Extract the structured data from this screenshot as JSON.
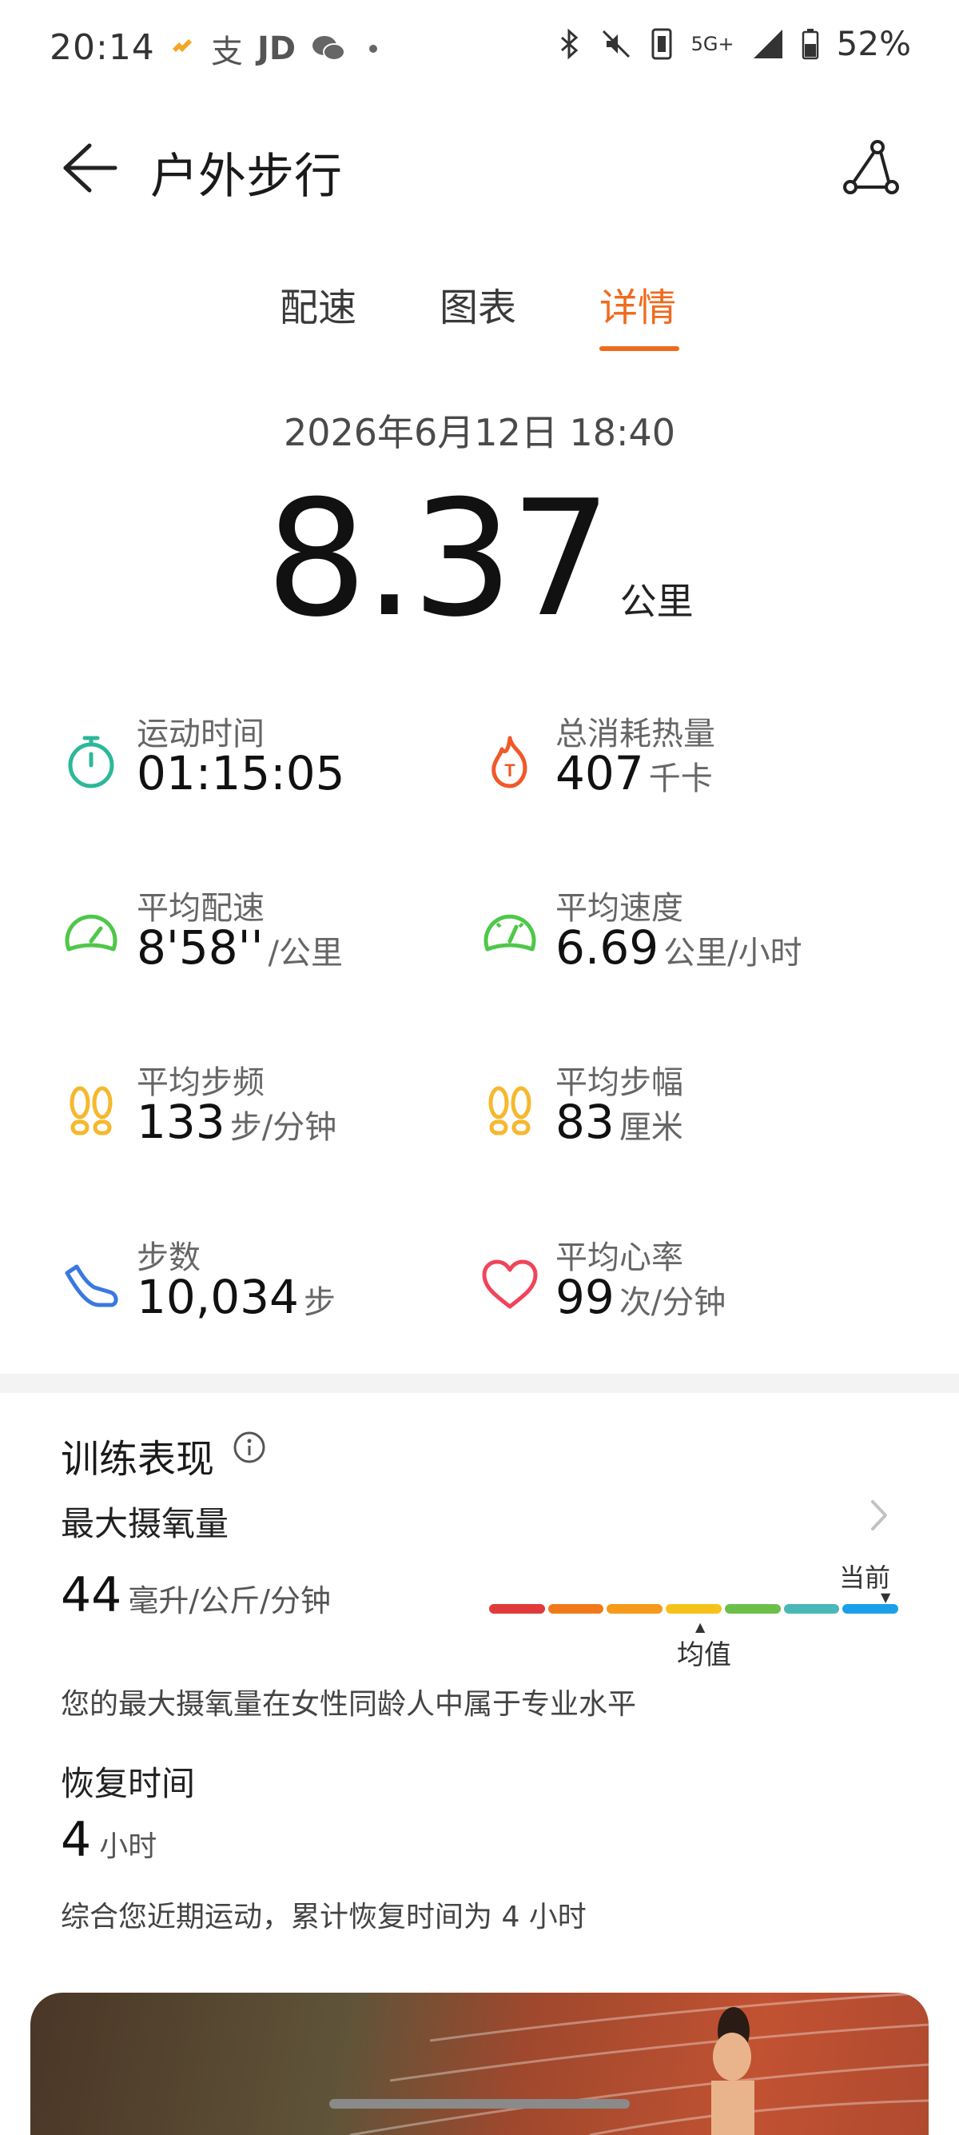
{
  "status_bar": {
    "time": "20:14",
    "left_icons": [
      "huawei-health-icon",
      "alipay-icon",
      "jd-icon",
      "wechat-icon",
      "dot-icon"
    ],
    "jd_text": "JD",
    "alipay_text": "支",
    "right_icons": [
      "bluetooth-icon",
      "mute-icon",
      "nfc-icon",
      "5g-icon",
      "signal-icon",
      "battery-icon"
    ],
    "network": "5G+",
    "battery": "52%"
  },
  "header": {
    "title": "户外步行"
  },
  "tabs": [
    {
      "label": "配速",
      "active": false
    },
    {
      "label": "图表",
      "active": false
    },
    {
      "label": "详情",
      "active": true
    }
  ],
  "summary": {
    "datetime": "2026年6月12日 18:40",
    "distance": "8.37",
    "distance_unit": "公里"
  },
  "metrics": [
    {
      "label": "运动时间",
      "value": "01:15:05",
      "unit": "",
      "icon": "stopwatch-icon",
      "color": "#2cb89a"
    },
    {
      "label": "总消耗热量",
      "value": "407",
      "unit": "千卡",
      "icon": "flame-icon",
      "color": "#f0582a"
    },
    {
      "label": "平均配速",
      "value": "8'58''",
      "unit": "/公里",
      "icon": "speedometer-icon",
      "color": "#4fc74a"
    },
    {
      "label": "平均速度",
      "value": "6.69",
      "unit": "公里/小时",
      "icon": "gauge-icon",
      "color": "#4fc74a"
    },
    {
      "label": "平均步频",
      "value": "133",
      "unit": "步/分钟",
      "icon": "footprints-icon",
      "color": "#f5b82e"
    },
    {
      "label": "平均步幅",
      "value": "83",
      "unit": "厘米",
      "icon": "footprints-icon",
      "color": "#f5b82e"
    },
    {
      "label": "步数",
      "value": "10,034",
      "unit": "步",
      "icon": "shoe-icon",
      "color": "#3a78e0"
    },
    {
      "label": "平均心率",
      "value": "99",
      "unit": "次/分钟",
      "icon": "heart-icon",
      "color": "#f0445a"
    }
  ],
  "training": {
    "title": "训练表现",
    "vo2_label": "最大摄氧量",
    "vo2_value": "44",
    "vo2_unit": "毫升/公斤/分钟",
    "scale_current_label": "当前",
    "scale_avg_label": "均值",
    "scale_colors": [
      "#e03a3a",
      "#f07a1a",
      "#f59a1a",
      "#f5c21a",
      "#6cc04a",
      "#4ab8b8",
      "#1aa0e8"
    ],
    "vo2_description": "您的最大摄氧量在女性同龄人中属于专业水平",
    "recovery_label": "恢复时间",
    "recovery_value": "4",
    "recovery_unit": "小时",
    "recovery_description": "综合您近期运动，累计恢复时间为 4 小时"
  }
}
